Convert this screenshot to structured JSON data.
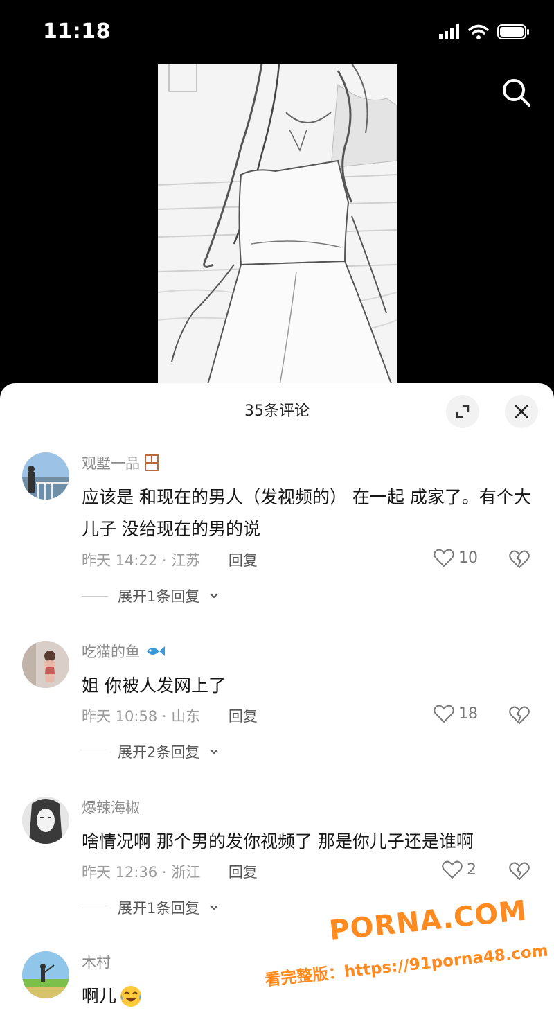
{
  "status_bar": {
    "time": "11:18"
  },
  "panel": {
    "title": "35条评论"
  },
  "comments": [
    {
      "username": "观墅一品",
      "badge_icon": "window-icon",
      "text": "应该是 和现在的男人（发视频的） 在一起 成家了。有个大儿子 没给现在的男的说",
      "time_location": "昨天 14:22 · 江苏",
      "reply_label": "回复",
      "likes": "10",
      "expand_replies": "展开1条回复"
    },
    {
      "username": "吃猫的鱼",
      "badge_icon": "fish-icon",
      "text": "姐 你被人发网上了",
      "time_location": "昨天 10:58 · 山东",
      "reply_label": "回复",
      "likes": "18",
      "expand_replies": "展开2条回复"
    },
    {
      "username": "爆辣海椒",
      "badge_icon": "",
      "text": "啥情况啊 那个男的发你视频了 那是你儿子还是谁啊",
      "time_location": "昨天 12:36 · 浙江",
      "reply_label": "回复",
      "likes": "2",
      "expand_replies": "展开1条回复"
    },
    {
      "username": "木村",
      "badge_icon": "",
      "text": "啊儿",
      "emoji_icon": "crying-laughing-emoji-icon"
    }
  ],
  "watermark": {
    "brand": "PORNA.COM",
    "line": "看完整版：https://91porna48.com"
  },
  "colors": {
    "watermark": "#ff8a1f",
    "panel_bg": "#ffffff",
    "background": "#000000"
  }
}
